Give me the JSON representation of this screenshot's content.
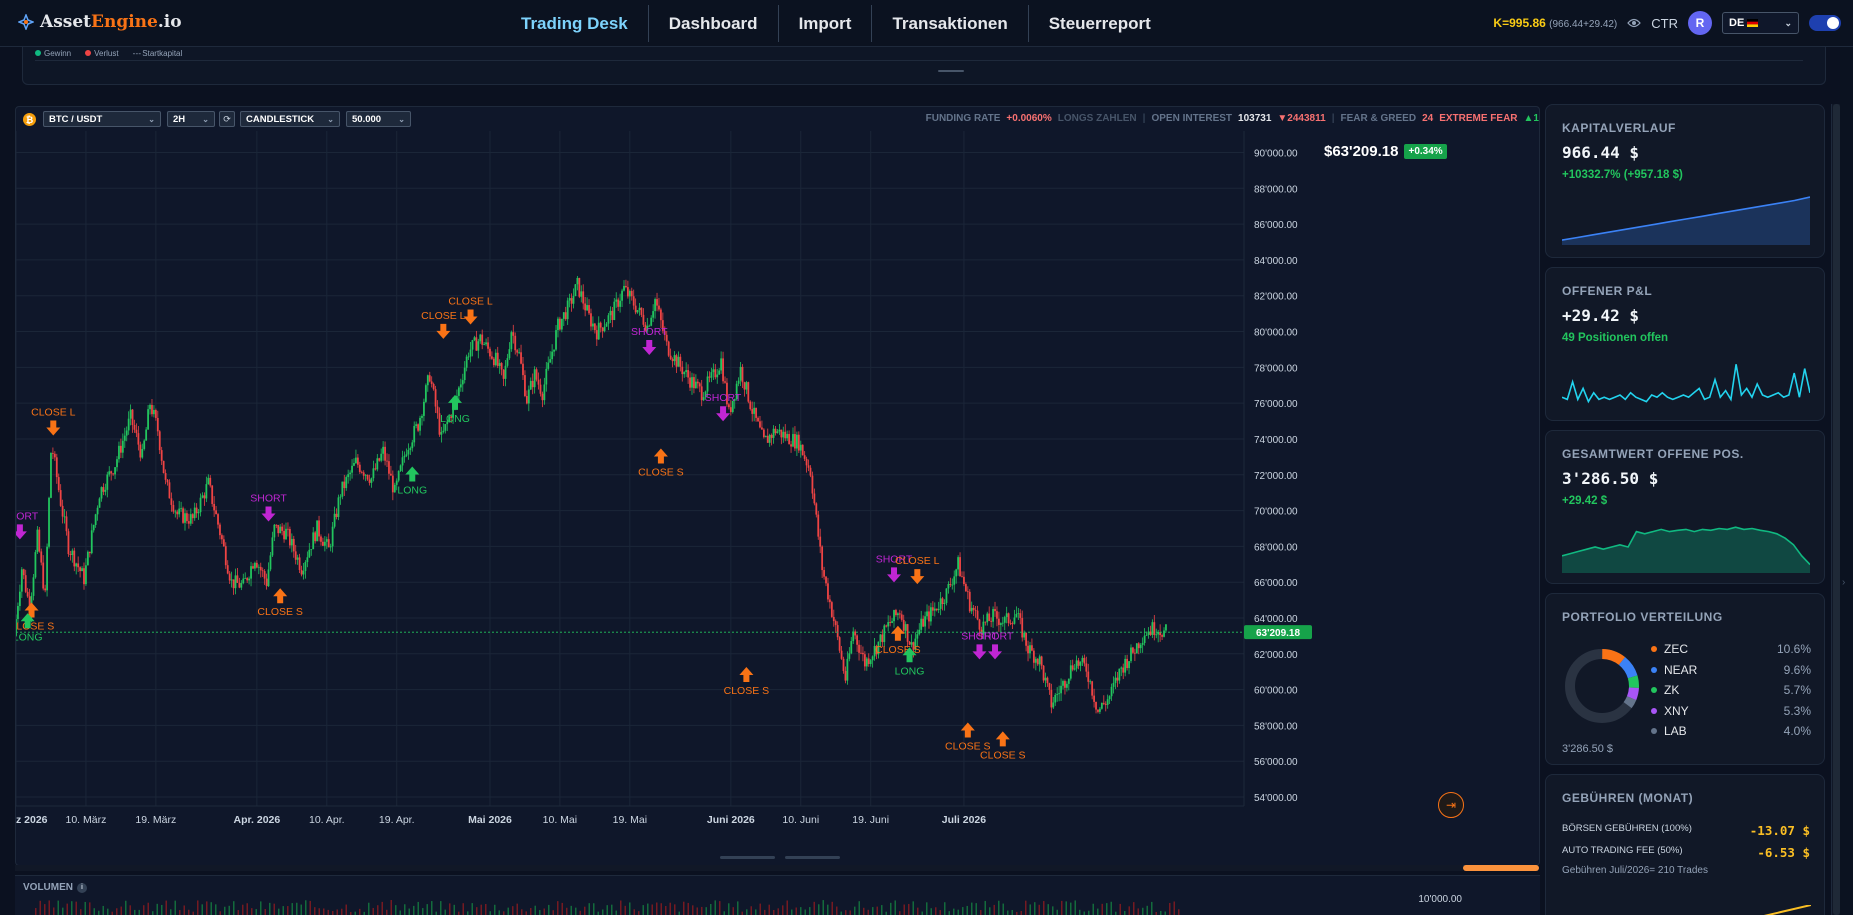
{
  "header": {
    "brand_part1": "Asset",
    "brand_part2": "Engine",
    "brand_part3": ".io",
    "nav": [
      {
        "label": "Trading Desk",
        "active": true
      },
      {
        "label": "Dashboard",
        "active": false
      },
      {
        "label": "Import",
        "active": false
      },
      {
        "label": "Transaktionen",
        "active": false
      },
      {
        "label": "Steuerreport",
        "active": false
      }
    ],
    "k_value": "K=995.86",
    "k_sub": "(966.44+29.42)",
    "ctr_label": "CTR",
    "avatar_initial": "R",
    "language": "DE"
  },
  "top_legend": {
    "items": [
      {
        "label": "Gewinn",
        "color": "#10b981"
      },
      {
        "label": "Verlust",
        "color": "#ef4444"
      },
      {
        "label": "Startkapital",
        "color": "#94a3b8"
      }
    ]
  },
  "chart_toolbar": {
    "pair": "BTC / USDT",
    "interval": "2H",
    "chart_type": "CANDLESTICK",
    "amount": "50.000",
    "funding_rate_label": "FUNDING RATE",
    "funding_rate_value": "+0.0060%",
    "funding_note": "LONGS ZAHLEN",
    "open_interest_label": "OPEN INTEREST",
    "open_interest_value": "103731",
    "open_interest_change": "▼2443811",
    "fear_greed_label": "FEAR & GREED",
    "fear_greed_value": "24",
    "fear_greed_text": "EXTREME FEAR",
    "fear_greed_trend": "▲1"
  },
  "current_price": {
    "value": "$63'209.18",
    "change": "+0.34%",
    "axis_tag": "63'209.18"
  },
  "chart_data": {
    "type": "candlestick",
    "y_ticks": [
      "90'000.00",
      "88'000.00",
      "86'000.00",
      "84'000.00",
      "82'000.00",
      "80'000.00",
      "78'000.00",
      "76'000.00",
      "74'000.00",
      "72'000.00",
      "70'000.00",
      "68'000.00",
      "66'000.00",
      "64'000.00",
      "62'000.00",
      "60'000.00",
      "58'000.00",
      "56'000.00",
      "54'000.00"
    ],
    "y_tick_values": [
      90000,
      88000,
      86000,
      84000,
      82000,
      80000,
      78000,
      76000,
      74000,
      72000,
      70000,
      68000,
      66000,
      64000,
      62000,
      60000,
      58000,
      56000,
      54000
    ],
    "ylim": [
      53500,
      91200
    ],
    "x_labels": [
      {
        "label": "z 2026",
        "day": 0,
        "bold": true
      },
      {
        "label": "10. März",
        "day": 9,
        "bold": false
      },
      {
        "label": "19. März",
        "day": 18,
        "bold": false
      },
      {
        "label": "Apr. 2026",
        "day": 31,
        "bold": true
      },
      {
        "label": "10. Apr.",
        "day": 40,
        "bold": false
      },
      {
        "label": "19. Apr.",
        "day": 49,
        "bold": false
      },
      {
        "label": "Mai 2026",
        "day": 61,
        "bold": true
      },
      {
        "label": "10. Mai",
        "day": 70,
        "bold": false
      },
      {
        "label": "19. Mai",
        "day": 79,
        "bold": false
      },
      {
        "label": "Juni 2026",
        "day": 92,
        "bold": true
      },
      {
        "label": "10. Juni",
        "day": 101,
        "bold": false
      },
      {
        "label": "19. Juni",
        "day": 110,
        "bold": false
      },
      {
        "label": "Juli 2026",
        "day": 122,
        "bold": true
      }
    ],
    "x_days_range": [
      0,
      157
    ],
    "price_path": [
      [
        0,
        63000
      ],
      [
        1,
        66800
      ],
      [
        2,
        64600
      ],
      [
        3,
        68500
      ],
      [
        4,
        65200
      ],
      [
        4.8,
        73800
      ],
      [
        6,
        70500
      ],
      [
        7,
        68000
      ],
      [
        9,
        66200
      ],
      [
        11,
        71000
      ],
      [
        13,
        72600
      ],
      [
        15,
        75200
      ],
      [
        16.5,
        73000
      ],
      [
        17.5,
        76000
      ],
      [
        18.5,
        74500
      ],
      [
        19.5,
        71500
      ],
      [
        21,
        69800
      ],
      [
        23,
        69500
      ],
      [
        25,
        71500
      ],
      [
        26.5,
        68800
      ],
      [
        28,
        66000
      ],
      [
        29.5,
        65800
      ],
      [
        31,
        67400
      ],
      [
        32.5,
        66000
      ],
      [
        33.5,
        69000
      ],
      [
        35,
        68800
      ],
      [
        37,
        66800
      ],
      [
        39,
        69000
      ],
      [
        40.5,
        67800
      ],
      [
        42,
        71000
      ],
      [
        44,
        72700
      ],
      [
        46,
        71800
      ],
      [
        47.5,
        73300
      ],
      [
        49,
        71000
      ],
      [
        50.5,
        73500
      ],
      [
        52,
        74800
      ],
      [
        53.5,
        77600
      ],
      [
        55,
        74000
      ],
      [
        57,
        76400
      ],
      [
        58.5,
        78900
      ],
      [
        60,
        79600
      ],
      [
        62,
        78400
      ],
      [
        63,
        77200
      ],
      [
        64,
        80100
      ],
      [
        65,
        78700
      ],
      [
        66,
        76200
      ],
      [
        67,
        77600
      ],
      [
        68,
        76600
      ],
      [
        70,
        80300
      ],
      [
        71.5,
        81500
      ],
      [
        72.5,
        82600
      ],
      [
        74,
        80800
      ],
      [
        75,
        80000
      ],
      [
        77,
        81000
      ],
      [
        78.5,
        82400
      ],
      [
        80,
        81400
      ],
      [
        81.5,
        80300
      ],
      [
        82.5,
        81800
      ],
      [
        84,
        79200
      ],
      [
        85.5,
        78200
      ],
      [
        87,
        77300
      ],
      [
        88.5,
        76600
      ],
      [
        90,
        77500
      ],
      [
        91,
        78400
      ],
      [
        92,
        75400
      ],
      [
        93.5,
        77900
      ],
      [
        95,
        75600
      ],
      [
        96.5,
        73800
      ],
      [
        98,
        74500
      ],
      [
        99.5,
        74100
      ],
      [
        101,
        73800
      ],
      [
        102.5,
        72200
      ],
      [
        104,
        66800
      ],
      [
        105.5,
        63900
      ],
      [
        107,
        60600
      ],
      [
        108,
        63300
      ],
      [
        109.5,
        61500
      ],
      [
        111,
        62400
      ],
      [
        112.5,
        63600
      ],
      [
        114,
        64400
      ],
      [
        115.5,
        62400
      ],
      [
        117,
        63800
      ],
      [
        118.5,
        64500
      ],
      [
        120,
        65400
      ],
      [
        121.5,
        67000
      ],
      [
        123,
        64800
      ],
      [
        124.5,
        63500
      ],
      [
        126,
        64100
      ],
      [
        127.5,
        63800
      ],
      [
        129,
        64200
      ],
      [
        130.5,
        62300
      ],
      [
        132,
        61600
      ],
      [
        133.5,
        59200
      ],
      [
        135,
        60300
      ],
      [
        136.5,
        61600
      ],
      [
        138,
        61200
      ],
      [
        139.5,
        58800
      ],
      [
        141,
        59600
      ],
      [
        142.5,
        61200
      ],
      [
        144,
        62100
      ],
      [
        145.5,
        63200
      ],
      [
        147,
        63500
      ],
      [
        148,
        63209
      ]
    ],
    "signals": [
      {
        "day": 0.5,
        "type": "SHORT",
        "label": "SHORT",
        "price": 68000,
        "dir": "down"
      },
      {
        "day": 2,
        "type": "CLOSE_S",
        "label": "CLOSE S",
        "price": 65200,
        "dir": "up"
      },
      {
        "day": 1.5,
        "type": "LONG",
        "label": "LONG",
        "price": 64600,
        "dir": "up"
      },
      {
        "day": 4.8,
        "type": "CLOSE_L",
        "label": "CLOSE L",
        "price": 73800,
        "dir": "down"
      },
      {
        "day": 32.5,
        "type": "SHORT",
        "label": "SHORT",
        "price": 69000,
        "dir": "down"
      },
      {
        "day": 34,
        "type": "CLOSE_S",
        "label": "CLOSE S",
        "price": 66000,
        "dir": "up"
      },
      {
        "day": 51,
        "type": "LONG",
        "label": "LONG",
        "price": 72800,
        "dir": "up"
      },
      {
        "day": 55,
        "type": "CLOSE_L",
        "label": "CLOSE L",
        "price": 79200,
        "dir": "down"
      },
      {
        "day": 56.5,
        "type": "LONG",
        "label": "LONG",
        "price": 76800,
        "dir": "up"
      },
      {
        "day": 58.5,
        "type": "CLOSE_L",
        "label": "CLOSE L",
        "price": 80000,
        "dir": "down"
      },
      {
        "day": 81.5,
        "type": "SHORT",
        "label": "SHORT",
        "price": 78300,
        "dir": "down"
      },
      {
        "day": 83,
        "type": "CLOSE_S",
        "label": "CLOSE S",
        "price": 73800,
        "dir": "up"
      },
      {
        "day": 91,
        "type": "SHORT",
        "label": "SHORT",
        "price": 74600,
        "dir": "down"
      },
      {
        "day": 94,
        "type": "CLOSE_S",
        "label": "CLOSE S",
        "price": 61600,
        "dir": "up"
      },
      {
        "day": 113,
        "type": "SHORT",
        "label": "SHORT",
        "price": 65600,
        "dir": "down"
      },
      {
        "day": 113.5,
        "type": "CLOSE_S",
        "label": "CLOSE S",
        "price": 63900,
        "dir": "up"
      },
      {
        "day": 115,
        "type": "LONG",
        "label": "LONG",
        "price": 62700,
        "dir": "up"
      },
      {
        "day": 116,
        "type": "CLOSE_L",
        "label": "CLOSE L",
        "price": 65500,
        "dir": "down"
      },
      {
        "day": 124,
        "type": "SHORT",
        "label": "SHORT",
        "price": 61300,
        "dir": "down"
      },
      {
        "day": 122.5,
        "type": "CLOSE_S",
        "label": "CLOSE S",
        "price": 58500,
        "dir": "up"
      },
      {
        "day": 126,
        "type": "SHORT",
        "label": "SHORT",
        "price": 61300,
        "dir": "down"
      },
      {
        "day": 127,
        "type": "CLOSE_S",
        "label": "CLOSE S",
        "price": 58000,
        "dir": "up"
      }
    ],
    "colors": {
      "up": "#22c55e",
      "down": "#ef4444",
      "short": "#c026d3",
      "long": "#22c55e",
      "close": "#f97316",
      "grid": "#1b2638",
      "price_line": "#22c55e"
    }
  },
  "volume": {
    "label": "VOLUMEN",
    "tick": "10'000.00"
  },
  "sidebar": {
    "kapitalverlauf": {
      "title": "KAPITALVERLAUF",
      "value": "966.44 $",
      "sub": "+10332.7% (+957.18 $)",
      "spark": [
        0.02,
        0.08,
        0.14,
        0.2,
        0.26,
        0.32,
        0.38,
        0.44,
        0.5,
        0.56,
        0.62,
        0.68,
        0.74,
        0.8,
        0.86,
        0.92,
        1.0
      ]
    },
    "offener_pnl": {
      "title": "OFFENER P&L",
      "value": "+29.42 $",
      "sub": "49 Positionen offen",
      "spark": [
        0.2,
        0.15,
        0.55,
        0.15,
        0.4,
        0.1,
        0.3,
        0.15,
        0.2,
        0.15,
        0.2,
        0.25,
        0.15,
        0.3,
        0.2,
        0.15,
        0.1,
        0.25,
        0.2,
        0.3,
        0.2,
        0.15,
        0.2,
        0.25,
        0.2,
        0.3,
        0.4,
        0.15,
        0.2,
        0.6,
        0.2,
        0.35,
        0.15,
        0.95,
        0.25,
        0.4,
        0.2,
        0.5,
        0.25,
        0.2,
        0.25,
        0.3,
        0.2,
        0.25,
        0.75,
        0.2,
        0.85,
        0.3
      ]
    },
    "gesamtwert": {
      "title": "GESAMTWERT OFFENE POS.",
      "value": "3'286.50 $",
      "sub": "+29.42 $",
      "spark": [
        0.3,
        0.35,
        0.4,
        0.45,
        0.5,
        0.45,
        0.5,
        0.55,
        0.5,
        0.85,
        0.8,
        0.85,
        0.9,
        0.85,
        0.88,
        0.9,
        0.85,
        0.9,
        0.88,
        0.92,
        0.9,
        0.95,
        0.9,
        0.92,
        0.88,
        0.85,
        0.8,
        0.7,
        0.55,
        0.3,
        0.1
      ]
    },
    "portfolio": {
      "title": "PORTFOLIO VERTEILUNG",
      "items": [
        {
          "name": "ZEC",
          "pct": "10.6%",
          "value": 10.6,
          "color": "#f97316"
        },
        {
          "name": "NEAR",
          "pct": "9.6%",
          "value": 9.6,
          "color": "#3b82f6"
        },
        {
          "name": "ZK",
          "pct": "5.7%",
          "value": 5.7,
          "color": "#22c55e"
        },
        {
          "name": "XNY",
          "pct": "5.3%",
          "value": 5.3,
          "color": "#a855f7"
        },
        {
          "name": "LAB",
          "pct": "4.0%",
          "value": 4.0,
          "color": "#64748b"
        }
      ],
      "total": "3'286.50 $"
    },
    "gebuehren": {
      "title": "GEBÜHREN (MONAT)",
      "rows": [
        {
          "label": "BÖRSEN GEBÜHREN (100%)",
          "value": "-13.07 $"
        },
        {
          "label": "AUTO TRADING FEE (50%)",
          "value": "-6.53 $"
        }
      ],
      "note": "Gebühren Juli/2026= 210 Trades"
    }
  }
}
